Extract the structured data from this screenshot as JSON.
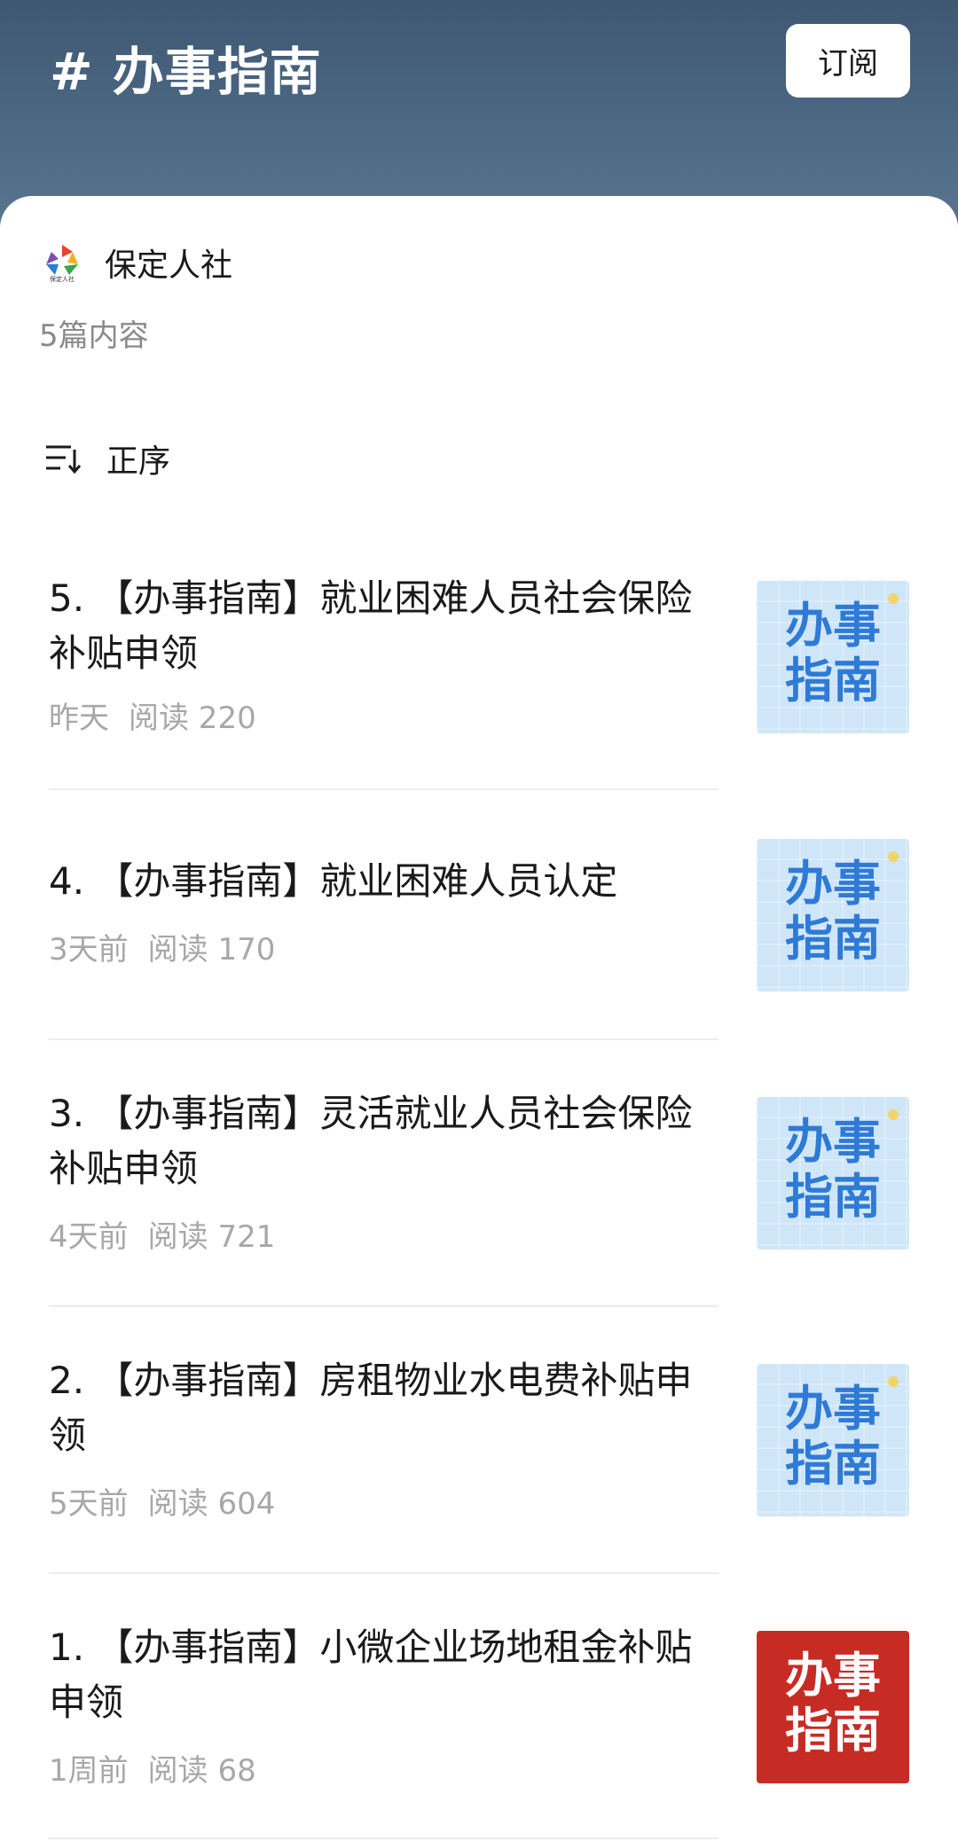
{
  "header": {
    "topic_title": "# 办事指南",
    "subscribe_label": "订阅"
  },
  "account": {
    "name": "保定人社",
    "logo_caption": "保定人社",
    "count_text": "5篇内容"
  },
  "sort": {
    "label": "正序"
  },
  "articles": [
    {
      "title": "5. 【办事指南】就业困难人员社会保险补贴申领",
      "time": "昨天",
      "reads": "阅读 220",
      "thumb_text": "办事指南",
      "thumb_style": "blue"
    },
    {
      "title": "4. 【办事指南】就业困难人员认定",
      "time": "3天前",
      "reads": "阅读 170",
      "thumb_text": "办事指南",
      "thumb_style": "blue"
    },
    {
      "title": "3. 【办事指南】灵活就业人员社会保险补贴申领",
      "time": "4天前",
      "reads": "阅读 721",
      "thumb_text": "办事指南",
      "thumb_style": "blue"
    },
    {
      "title": "2. 【办事指南】房租物业水电费补贴申领",
      "time": "5天前",
      "reads": "阅读 604",
      "thumb_text": "办事指南",
      "thumb_style": "blue"
    },
    {
      "title": "1. 【办事指南】小微企业场地租金补贴申领",
      "time": "1周前",
      "reads": "阅读 68",
      "thumb_text": "办事指南",
      "thumb_style": "red"
    }
  ],
  "colors": {
    "header_top": "#3f5872",
    "thumb_blue_bg": "#cfe6f8",
    "thumb_blue_text": "#2f7ad6",
    "thumb_red_bg": "#c62c24",
    "meta_gray": "#a8a8a8"
  },
  "icons": {
    "sort": "sort-lines-icon",
    "logo": "pentagon-logo-icon"
  }
}
